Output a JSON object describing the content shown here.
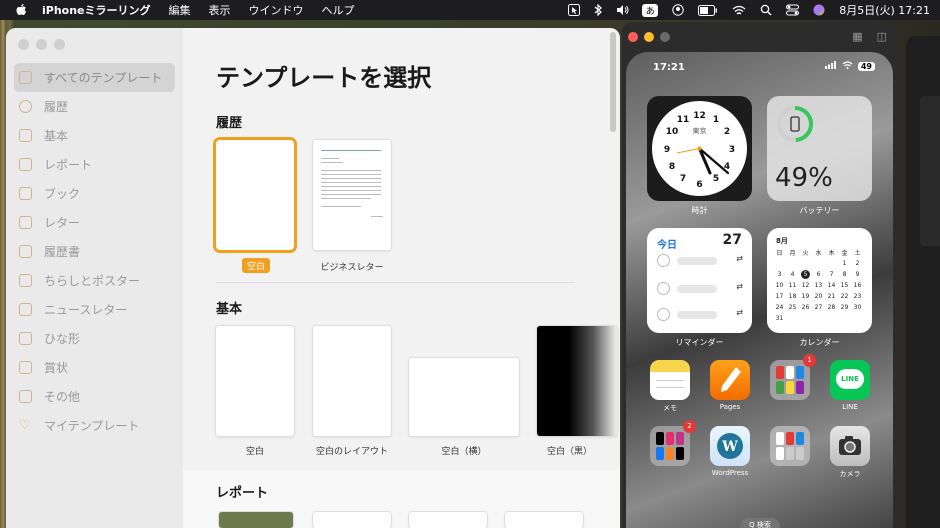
{
  "menubar": {
    "app_name": "iPhoneミラーリング",
    "menus": [
      "編集",
      "表示",
      "ウインドウ",
      "ヘルプ"
    ],
    "input_method": "あ",
    "date_time": "8月5日(火)  17:21"
  },
  "pages": {
    "title": "テンプレートを選択",
    "sidebar": [
      {
        "label": "すべてのテンプレート",
        "icon": "grid-icon",
        "active": true
      },
      {
        "label": "履歴",
        "icon": "clock-icon"
      },
      {
        "label": "基本",
        "icon": "doc-icon"
      },
      {
        "label": "レポート",
        "icon": "report-icon"
      },
      {
        "label": "ブック",
        "icon": "book-icon"
      },
      {
        "label": "レター",
        "icon": "letter-icon"
      },
      {
        "label": "履歴書",
        "icon": "resume-icon"
      },
      {
        "label": "ちらしとポスター",
        "icon": "poster-icon"
      },
      {
        "label": "ニュースレター",
        "icon": "newsletter-icon"
      },
      {
        "label": "ひな形",
        "icon": "stationery-icon"
      },
      {
        "label": "賞状",
        "icon": "certificate-icon"
      },
      {
        "label": "その他",
        "icon": "misc-icon"
      },
      {
        "label": "マイテンプレート",
        "icon": "heart-icon"
      }
    ],
    "sections": {
      "recent": {
        "title": "履歴",
        "items": [
          {
            "label": "空白",
            "selected": true
          },
          {
            "label": "ビジネスレター"
          }
        ]
      },
      "basic": {
        "title": "基本",
        "items": [
          {
            "label": "空白"
          },
          {
            "label": "空白のレイアウト"
          },
          {
            "label": "空白（横）"
          },
          {
            "label": "空白（黒）"
          }
        ]
      },
      "report": {
        "title": "レポート"
      }
    }
  },
  "iphone": {
    "status_time": "17:21",
    "battery": "49",
    "widgets": {
      "clock": {
        "label": "時計",
        "city": "東京"
      },
      "battery": {
        "label": "バッテリー",
        "percent": "49%"
      },
      "reminders": {
        "label": "リマインダー",
        "title": "今日",
        "count": "27"
      },
      "calendar": {
        "label": "カレンダー",
        "month": "8月",
        "weekdays": [
          "日",
          "月",
          "火",
          "水",
          "木",
          "金",
          "土"
        ],
        "today": "5"
      }
    },
    "apps": [
      {
        "label": "メモ",
        "icon": "notes-icon"
      },
      {
        "label": "Pages",
        "icon": "pages-icon"
      },
      {
        "label": "",
        "icon": "folder-icon",
        "badge": "1"
      },
      {
        "label": "LINE",
        "icon": "line-icon",
        "text": "LINE"
      },
      {
        "label": "",
        "icon": "folder-icon",
        "badge": "2"
      },
      {
        "label": "WordPress",
        "icon": "wordpress-icon"
      },
      {
        "label": "",
        "icon": "folder-icon"
      },
      {
        "label": "カメラ",
        "icon": "camera-icon"
      }
    ],
    "search": "Q 検索"
  }
}
